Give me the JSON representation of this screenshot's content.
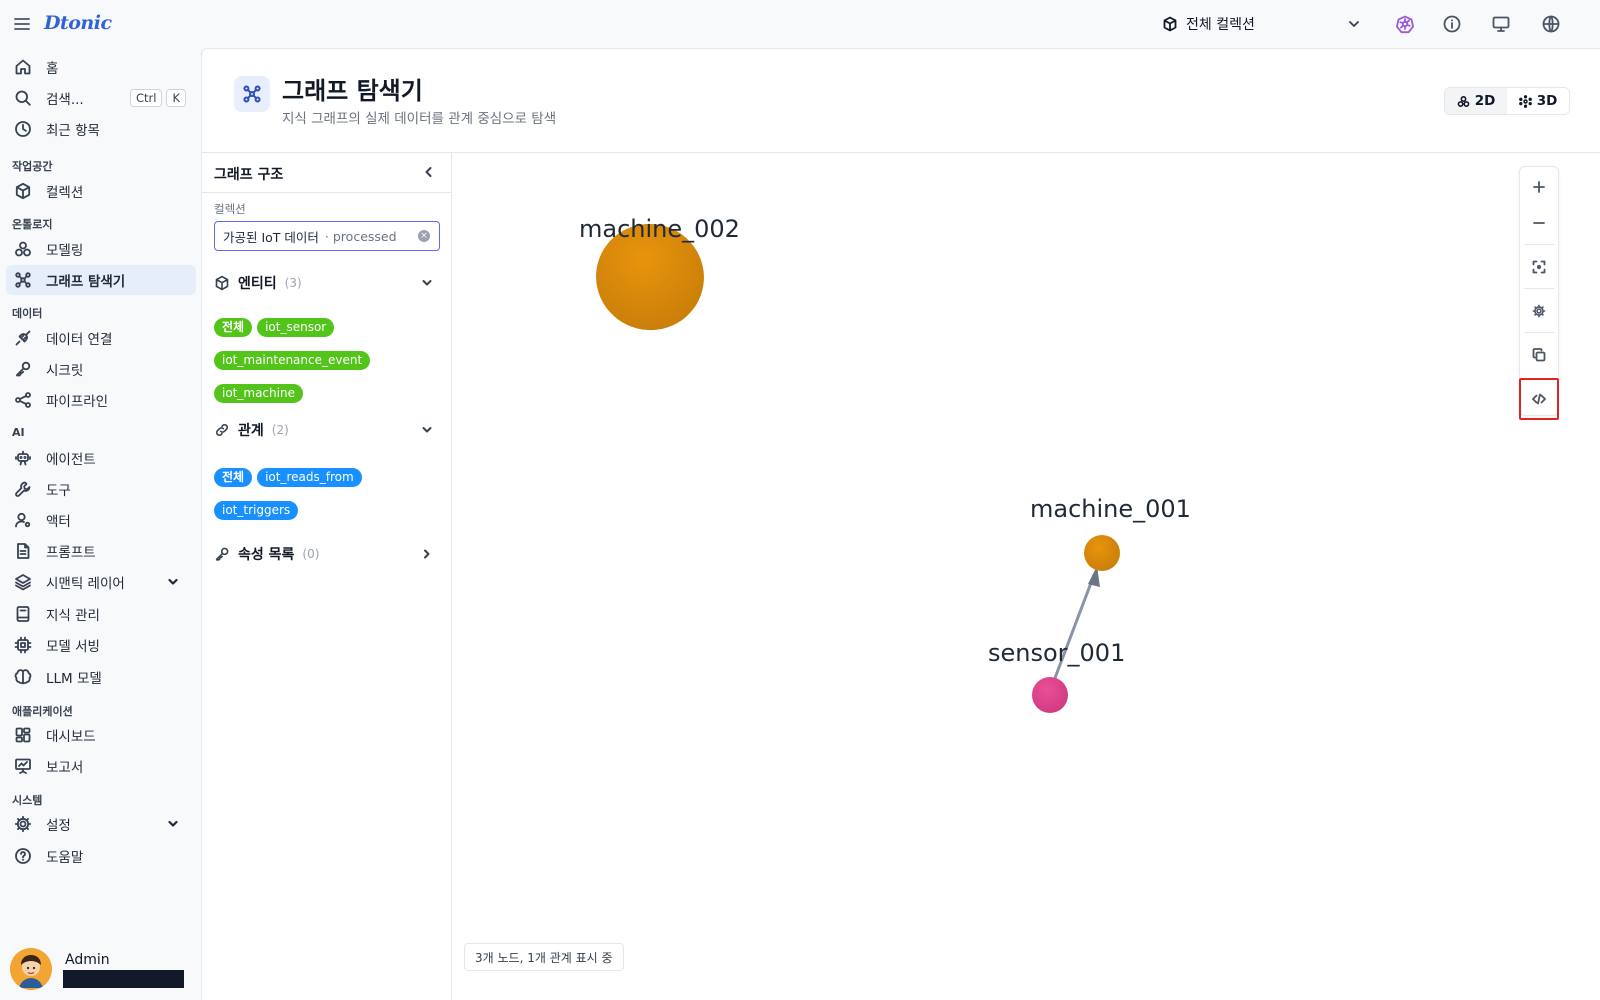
{
  "topbar": {
    "logo": "Dtonic",
    "collection_selector": "전체 컬렉션",
    "icons": [
      "menu-icon",
      "box-icon",
      "chevron-down-icon",
      "kubernetes-icon",
      "info-icon",
      "monitor-icon",
      "globe-icon"
    ]
  },
  "sidebar": {
    "home": "홈",
    "search": "검색...",
    "search_shortcut": [
      "Ctrl",
      "K"
    ],
    "recent": "최근 항목",
    "sections": {
      "workspace": "작업공간",
      "ontology": "온톨로지",
      "data": "데이터",
      "ai": "AI",
      "applications": "애플리케이션",
      "system": "시스템"
    },
    "items": {
      "collection": "컬렉션",
      "modeling": "모델링",
      "graph_explorer": "그래프 탐색기",
      "data_connection": "데이터 연결",
      "secret": "시크릿",
      "pipeline": "파이프라인",
      "agent": "에이전트",
      "tool": "도구",
      "actor": "액터",
      "prompt": "프롬프트",
      "semantic_layer": "시맨틱 레이어",
      "knowledge": "지식 관리",
      "model_serving": "모델 서빙",
      "llm_model": "LLM 모델",
      "dashboard": "대시보드",
      "report": "보고서",
      "settings": "설정",
      "help": "도움말"
    },
    "active_item": "graph_explorer",
    "user": {
      "name": "Admin"
    }
  },
  "header": {
    "title": "그래프 탐색기",
    "subtitle": "지식 그래프의 실제 데이터를 관계 중심으로 탐색",
    "view_modes": [
      "2D",
      "3D"
    ],
    "active_view": "2D"
  },
  "structure_panel": {
    "title": "그래프 구조",
    "collection_label": "컬렉션",
    "collection_value": "가공된 IoT 데이터",
    "collection_sub": "· processed",
    "entities": {
      "label": "엔티티",
      "count": "(3)",
      "tags": [
        "전체",
        "iot_sensor",
        "iot_maintenance_event",
        "iot_machine"
      ],
      "color": "#52c41a"
    },
    "relations": {
      "label": "관계",
      "count": "(2)",
      "tags": [
        "전체",
        "iot_reads_from",
        "iot_triggers"
      ],
      "color": "#1890ff"
    },
    "properties": {
      "label": "속성 목록",
      "count": "(0)"
    }
  },
  "graph": {
    "nodes": [
      {
        "id": "machine_002",
        "type": "iot_machine",
        "color": "#e8940c"
      },
      {
        "id": "machine_001",
        "type": "iot_machine",
        "color": "#e8940c"
      },
      {
        "id": "sensor_001",
        "type": "iot_sensor",
        "color": "#e0448c"
      }
    ],
    "edges": [
      {
        "source": "sensor_001",
        "target": "machine_001",
        "color": "#8a94a6"
      }
    ],
    "status": "3개 노드, 1개 관계 표시 중",
    "controls": [
      "zoom-in",
      "zoom-out",
      "fit-view",
      "settings",
      "copy",
      "code"
    ]
  }
}
